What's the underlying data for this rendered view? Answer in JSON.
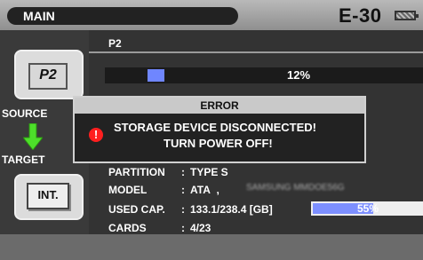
{
  "header": {
    "title": "MAIN",
    "model": "E-30",
    "battery_icon": "battery-icon"
  },
  "source": {
    "label": "SOURCE",
    "chip": "P2",
    "icon": "p2-card-icon"
  },
  "target": {
    "label": "TARGET",
    "chip": "INT.",
    "icon": "internal-storage-icon"
  },
  "panel": {
    "device_label": "P2",
    "progress_percent": 12,
    "progress_text": "12%"
  },
  "info": {
    "partition_key": "PARTITION",
    "partition_val": "TYPE S",
    "model_key": "MODEL",
    "model_val": "ATA",
    "model_blur": "SAMSUNG MMDOE56G",
    "used_key": "USED CAP.",
    "used_val": "133.1/238.4 [GB]",
    "used_percent": 55,
    "used_text": "55%",
    "cards_key": "CARDS",
    "cards_val": "4/23"
  },
  "dialog": {
    "title": "ERROR",
    "icon": "error-icon",
    "line1": "STORAGE DEVICE DISCONNECTED!",
    "line2": "TURN POWER OFF!"
  },
  "colors": {
    "accent_blue": "#6f86ff",
    "error_red": "#ff1f1f",
    "arrow_green": "#4ddf2a"
  }
}
